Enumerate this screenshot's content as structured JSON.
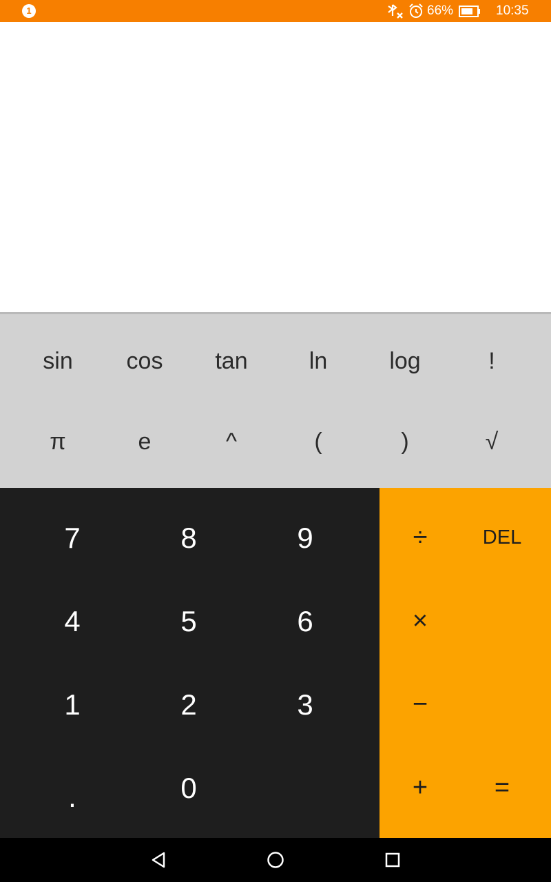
{
  "status_bar": {
    "notification_count": "1",
    "battery_percent": "66%",
    "time": "10:35",
    "icons": [
      "bluetooth-off-icon",
      "alarm-icon",
      "battery-icon"
    ],
    "background_color": "#f77f00"
  },
  "display": {
    "expression": ""
  },
  "scientific_keys": {
    "row1": [
      "sin",
      "cos",
      "tan",
      "ln",
      "log",
      "!"
    ],
    "row2": [
      "π",
      "e",
      "^",
      "(",
      ")",
      "√"
    ]
  },
  "number_keys": {
    "row1": [
      "7",
      "8",
      "9"
    ],
    "row2": [
      "4",
      "5",
      "6"
    ],
    "row3": [
      "1",
      "2",
      "3"
    ],
    "row4": [
      ".",
      "0"
    ]
  },
  "operator_keys": {
    "divide": "÷",
    "delete": "DEL",
    "multiply": "×",
    "subtract": "−",
    "add": "+",
    "equals": "="
  },
  "colors": {
    "status_bar": "#f77f00",
    "scientific_panel": "#d2d2d2",
    "numpad": "#1e1e1e",
    "operator_panel": "#fca300",
    "nav_bar": "#000000"
  },
  "navbar": {
    "icons": [
      "back-icon",
      "home-icon",
      "recents-icon"
    ]
  }
}
